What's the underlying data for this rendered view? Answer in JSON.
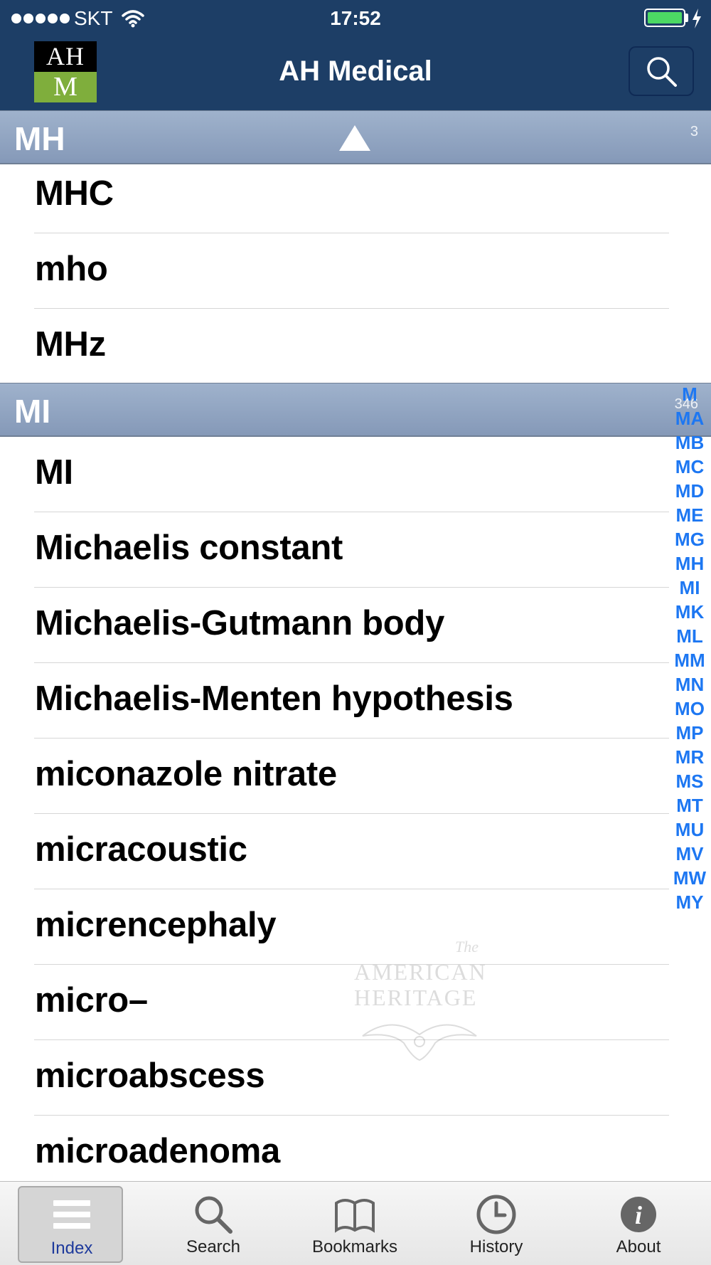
{
  "status_bar": {
    "carrier": "SKT",
    "time": "17:52"
  },
  "app": {
    "title": "AH Medical",
    "logo_top": "AH",
    "logo_bottom": "M"
  },
  "sections": [
    {
      "title": "MH",
      "count": "3",
      "items": [
        "MHC",
        "mho",
        "MHz"
      ]
    },
    {
      "title": "MI",
      "count": "346",
      "items": [
        "MI",
        "Michaelis constant",
        "Michaelis-Gutmann body",
        "Michaelis-Menten hypothesis",
        "miconazole nitrate",
        "micracoustic",
        "micrencephaly",
        "micro–",
        "microabscess",
        "microadenoma"
      ]
    }
  ],
  "index_bar": [
    "M",
    "MA",
    "MB",
    "MC",
    "MD",
    "ME",
    "MG",
    "MH",
    "MI",
    "MK",
    "ML",
    "MM",
    "MN",
    "MO",
    "MP",
    "MR",
    "MS",
    "MT",
    "MU",
    "MV",
    "MW",
    "MY"
  ],
  "watermark": {
    "line1": "The",
    "line2": "AMERICAN",
    "line3": "HERITAGE"
  },
  "tabs": [
    {
      "label": "Index",
      "icon": "list-icon",
      "selected": true
    },
    {
      "label": "Search",
      "icon": "search-icon",
      "selected": false
    },
    {
      "label": "Bookmarks",
      "icon": "book-icon",
      "selected": false
    },
    {
      "label": "History",
      "icon": "clock-icon",
      "selected": false
    },
    {
      "label": "About",
      "icon": "info-icon",
      "selected": false
    }
  ],
  "colors": {
    "nav_bar": "#1d3e66",
    "section_header": "#8fa3c0",
    "index_text": "#1d77f2",
    "logo_green": "#7fae3c",
    "battery": "#4cd964"
  }
}
